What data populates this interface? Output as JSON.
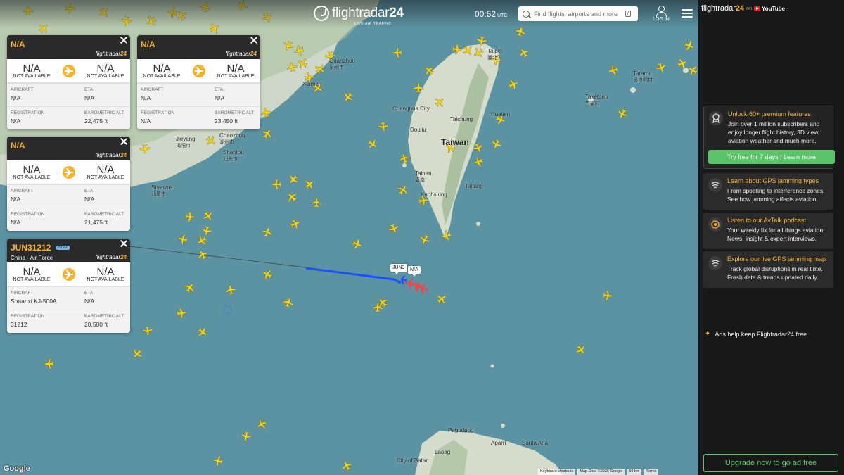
{
  "header": {
    "logo_text": "flightradar",
    "logo_num": "24",
    "logo_sub": "LIVE AIR TRAFFIC",
    "clock": "00:52",
    "clock_unit": "UTC",
    "search_placeholder": "Find flights, airports and more",
    "search_shortcut": "/",
    "login_label": "LOG IN",
    "menu_icon": "hamburger-menu-icon"
  },
  "cards": [
    {
      "callsign": "N/A",
      "badge": "",
      "operator": "",
      "origin": "N/A",
      "origin_name": "NOT AVAILABLE",
      "dest": "N/A",
      "dest_name": "NOT AVAILABLE",
      "aircraft_label": "AIRCRAFT",
      "aircraft": "N/A",
      "eta_label": "ETA",
      "eta": "N/A",
      "reg_label": "REGISTRATION",
      "reg": "N/A",
      "alt_label": "BAROMETRIC ALT.",
      "alt": "22,475 ft"
    },
    {
      "callsign": "N/A",
      "badge": "",
      "operator": "",
      "origin": "N/A",
      "origin_name": "NOT AVAILABLE",
      "dest": "N/A",
      "dest_name": "NOT AVAILABLE",
      "aircraft_label": "AIRCRAFT",
      "aircraft": "N/A",
      "eta_label": "ETA",
      "eta": "N/A",
      "reg_label": "REGISTRATION",
      "reg": "N/A",
      "alt_label": "BAROMETRIC ALT.",
      "alt": "23,450 ft"
    },
    {
      "callsign": "N/A",
      "badge": "",
      "operator": "",
      "origin": "N/A",
      "origin_name": "NOT AVAILABLE",
      "dest": "N/A",
      "dest_name": "NOT AVAILABLE",
      "aircraft_label": "AIRCRAFT",
      "aircraft": "N/A",
      "eta_label": "ETA",
      "eta": "N/A",
      "reg_label": "REGISTRATION",
      "reg": "N/A",
      "alt_label": "BAROMETRIC ALT.",
      "alt": "21,475 ft"
    },
    {
      "callsign": "JUN31212",
      "badge": "ZZZZ",
      "operator": "China - Air Force",
      "origin": "N/A",
      "origin_name": "NOT AVAILABLE",
      "dest": "N/A",
      "dest_name": "NOT AVAILABLE",
      "aircraft_label": "AIRCRAFT",
      "aircraft": "Shaanxi KJ-500A",
      "eta_label": "ETA",
      "eta": "N/A",
      "reg_label": "REGISTRATION",
      "reg": "31212",
      "alt_label": "BAROMETRIC ALT.",
      "alt": "20,500 ft"
    }
  ],
  "card_brand": {
    "text": "flightradar",
    "num": "24"
  },
  "map_labels": {
    "flight_a": "JUN3",
    "flight_b": "N/A"
  },
  "places": [
    {
      "name": "Quanzhou",
      "sub": "泉州市",
      "big": false
    },
    {
      "name": "Xiamen",
      "sub": "",
      "big": false
    },
    {
      "name": "Taipei",
      "sub": "臺北",
      "big": false
    },
    {
      "name": "Changhua City",
      "sub": "",
      "big": false
    },
    {
      "name": "Douliu",
      "sub": "",
      "big": false
    },
    {
      "name": "Taichung",
      "sub": "",
      "big": false
    },
    {
      "name": "Hualien",
      "sub": "",
      "big": false
    },
    {
      "name": "Taiwan",
      "sub": "",
      "big": true
    },
    {
      "name": "Tainan",
      "sub": "臺南",
      "big": false
    },
    {
      "name": "Kaohsiung",
      "sub": "",
      "big": false
    },
    {
      "name": "Taitung",
      "sub": "",
      "big": false
    },
    {
      "name": "Jieyang",
      "sub": "揭阳市",
      "big": false
    },
    {
      "name": "Chaozhou",
      "sub": "潮州市",
      "big": false
    },
    {
      "name": "Shantou",
      "sub": "汕头市",
      "big": false
    },
    {
      "name": "Shanwei",
      "sub": "汕尾市",
      "big": false
    },
    {
      "name": "Tarama",
      "sub": "多良間村",
      "big": false
    },
    {
      "name": "Taketomi",
      "sub": "竹富町",
      "big": false
    },
    {
      "name": "Pagudpud",
      "sub": "",
      "big": false
    },
    {
      "name": "Aparri",
      "sub": "",
      "big": false
    },
    {
      "name": "Santa Ana",
      "sub": "",
      "big": false
    },
    {
      "name": "Laoag",
      "sub": "",
      "big": false
    },
    {
      "name": "City of Batac",
      "sub": "",
      "big": false
    }
  ],
  "attribution": {
    "google": "Google",
    "shortcuts": "Keyboard shortcuts",
    "mapdata": "Map Data ©2026 Google",
    "scale": "50 km",
    "terms": "Terms"
  },
  "sidebar": {
    "brand": "flightradar",
    "brand_num": "24",
    "on": "on",
    "youtube": "YouTube",
    "promos": [
      {
        "title": "Unlock 60+ premium features",
        "text": "Join over 1 million subscribers and enjoy longer flight history, 3D view, aviation weather and much more.",
        "button": "Try free for 7 days | Learn more",
        "icon": "premium-badge-icon"
      },
      {
        "title": "Learn about GPS jamming types",
        "text": "From spoofing to interference zones. See how jamming affects aviation.",
        "icon": "gps-jamming-icon"
      },
      {
        "title": "Listen to our AvTalk podcast",
        "text": "Your weekly fix for all things aviation. News, insight & expert interviews.",
        "icon": "podcast-icon"
      },
      {
        "title": "Explore our live GPS jamming map",
        "text": "Track global disruptions in real time. Fresh data & trends updated daily.",
        "icon": "gps-map-icon"
      }
    ],
    "ads_note": "Ads help keep Flightradar24 free",
    "adfree": "Upgrade now to go ad free"
  },
  "colors": {
    "accent": "#f7b32b",
    "green": "#5ac46b",
    "sea": "#5b93a2",
    "land": "#d9dfd2"
  }
}
